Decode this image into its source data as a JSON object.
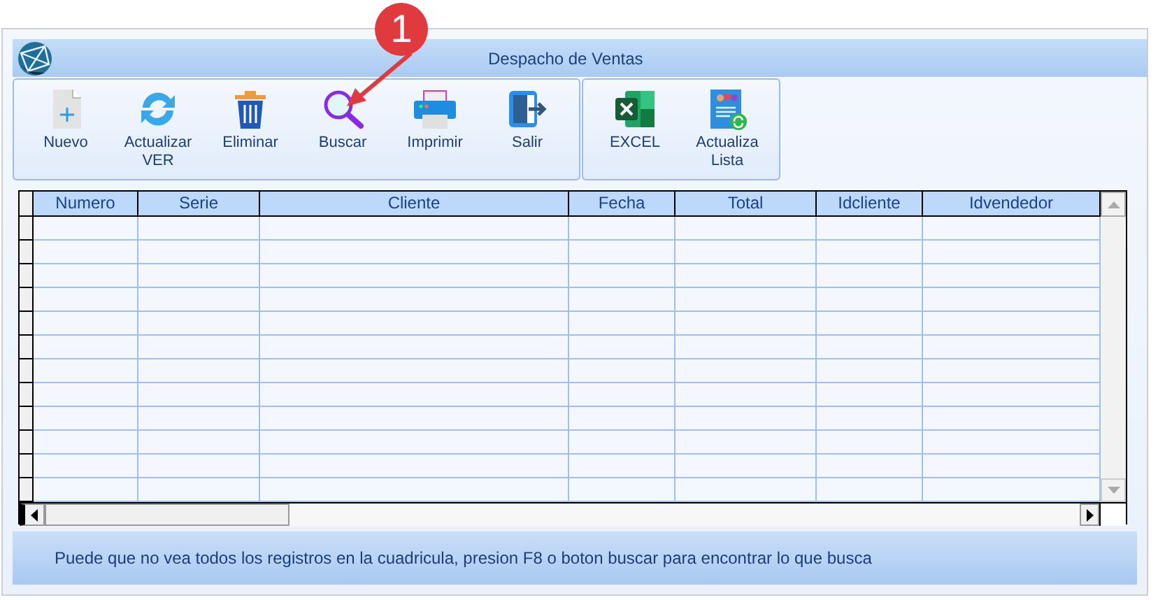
{
  "window": {
    "title": "Despacho de Ventas"
  },
  "toolbar_groups": [
    {
      "buttons": [
        {
          "label": "Nuevo"
        },
        {
          "label": "Actualizar VER"
        },
        {
          "label": "Eliminar"
        },
        {
          "label": "Buscar"
        },
        {
          "label": "Imprimir"
        },
        {
          "label": "Salir"
        }
      ]
    },
    {
      "buttons": [
        {
          "label": "EXCEL"
        },
        {
          "label": "Actualiza Lista"
        }
      ]
    }
  ],
  "annotation": {
    "label": "1"
  },
  "table": {
    "columns": [
      "Numero",
      "Serie",
      "Cliente",
      "Fecha",
      "Total",
      "Idcliente",
      "Idvendedor"
    ]
  },
  "status_bar": {
    "text": "Puede que no vea todos los registros en la cuadricula, presion F8 o boton buscar para encontrar lo que busca"
  }
}
